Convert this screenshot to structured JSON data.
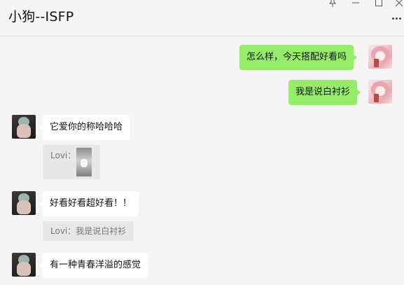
{
  "window": {
    "title": "小狗--ISFP"
  },
  "messages": [
    {
      "side": "self",
      "text": "怎么样，今天搭配好看吗"
    },
    {
      "side": "self",
      "text": "我是说白衬衫"
    },
    {
      "side": "other",
      "text": "它爱你的称哈哈哈"
    },
    {
      "side": "other",
      "quote_prefix": "Lovi：",
      "quote_type": "image"
    },
    {
      "side": "other",
      "text": "好看好看超好看！！"
    },
    {
      "side": "other",
      "quote_text": "Lovi：我是说白衬衫"
    },
    {
      "side": "other",
      "text": "有一种青春洋溢的感觉"
    }
  ],
  "colors": {
    "self_bubble": "#95ec69",
    "other_bubble": "#ffffff",
    "background": "#f5f5f5",
    "quote_bg": "#e7e7e7"
  },
  "icons": [
    "pin-icon",
    "minimize-icon",
    "maximize-icon",
    "close-icon",
    "more-icon"
  ]
}
